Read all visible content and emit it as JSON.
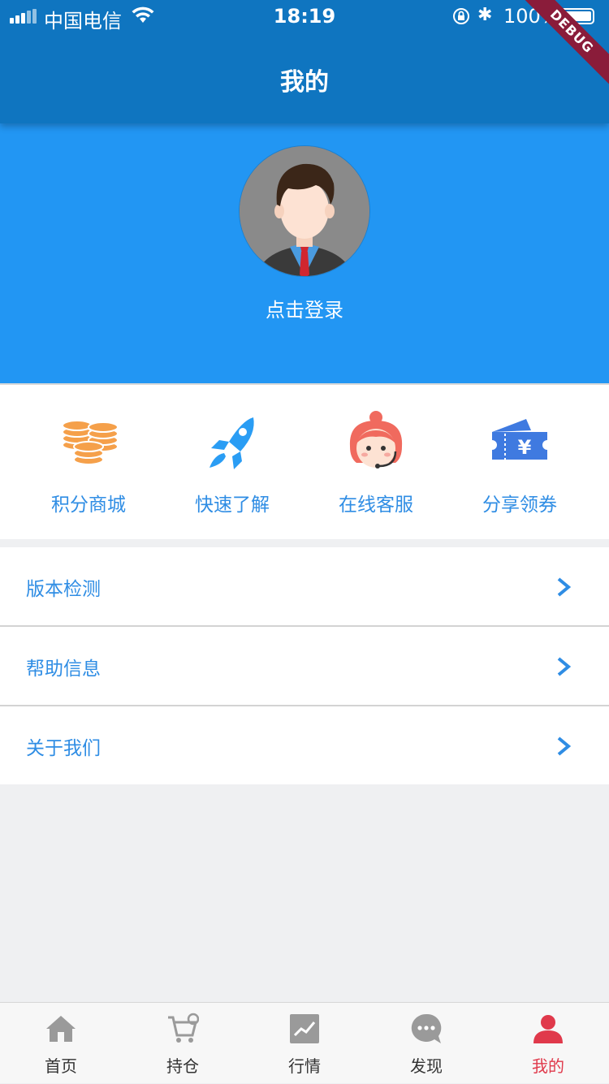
{
  "status_bar": {
    "carrier": "中国电信",
    "time": "18:19",
    "battery_percent": "100%",
    "debug_banner": "DEBUG"
  },
  "header": {
    "title": "我的"
  },
  "profile": {
    "login_label": "点击登录"
  },
  "quick_actions": [
    {
      "label": "积分商城",
      "icon": "coins-icon",
      "color": "#f5a04a"
    },
    {
      "label": "快速了解",
      "icon": "rocket-icon",
      "color": "#2a9df4"
    },
    {
      "label": "在线客服",
      "icon": "customer-service-icon",
      "color": "#f06a5e"
    },
    {
      "label": "分享领券",
      "icon": "coupon-icon",
      "color": "#3f7ae0"
    }
  ],
  "menu": [
    {
      "label": "版本检测"
    },
    {
      "label": "帮助信息"
    },
    {
      "label": "关于我们"
    }
  ],
  "tabs": [
    {
      "label": "首页",
      "icon": "home-icon"
    },
    {
      "label": "持仓",
      "icon": "cart-icon"
    },
    {
      "label": "行情",
      "icon": "chart-icon"
    },
    {
      "label": "发现",
      "icon": "chat-bubble-icon"
    },
    {
      "label": "我的",
      "icon": "user-icon",
      "active": true
    }
  ],
  "colors": {
    "header": "#0f75c0",
    "profile_bg": "#2296f3",
    "accent_text": "#2f8de4",
    "active_tab": "#e0394b"
  }
}
